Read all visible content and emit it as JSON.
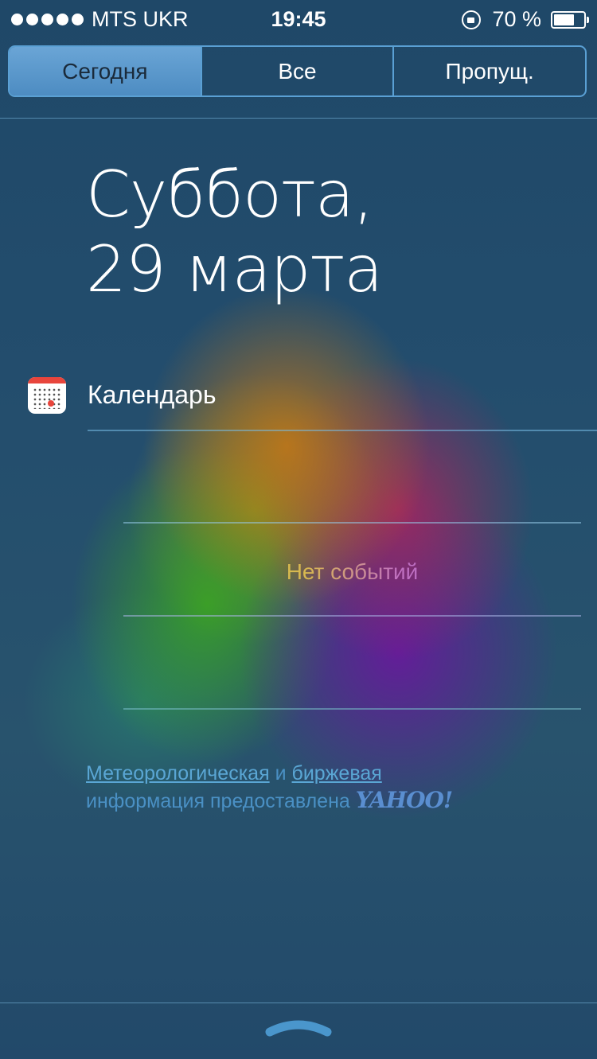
{
  "status_bar": {
    "carrier": "MTS UKR",
    "time": "19:45",
    "battery_percent": "70 %",
    "battery_level": 0.7,
    "signal_dots": 5
  },
  "tabs": [
    {
      "label": "Сегодня",
      "active": true
    },
    {
      "label": "Все",
      "active": false
    },
    {
      "label": "Пропущ.",
      "active": false
    }
  ],
  "today": {
    "weekday": "Суббота,",
    "date": "29 марта"
  },
  "calendar": {
    "title": "Календарь",
    "empty_text": "Нет событий"
  },
  "attribution": {
    "weather_link": "Метеорологическая",
    "and": "и",
    "stocks_link": "биржевая",
    "text": "информация предоставлена",
    "brand": "YAHOO!"
  },
  "colors": {
    "accent": "#5aa0d4",
    "tab_active": "#5a9ad0",
    "calendar_red": "#e8453c"
  },
  "icons": [
    "signal-dots-icon",
    "orientation-lock-icon",
    "battery-icon",
    "calendar-icon",
    "grabber-handle-icon"
  ]
}
